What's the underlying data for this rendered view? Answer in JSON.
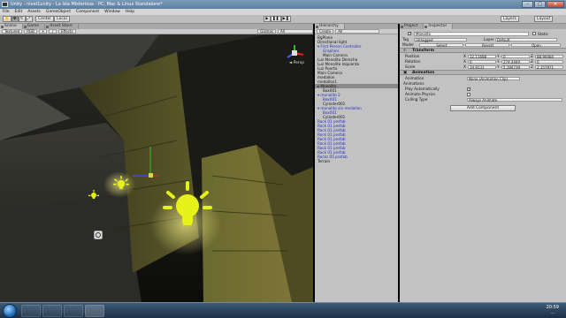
{
  "window": {
    "title": "Unity - nivel1unity - La Isla Misteriosa - PC, Mac & Linux Standalone*",
    "minimize": "–",
    "maximize": "□",
    "close": "✕"
  },
  "menu": [
    "File",
    "Edit",
    "Assets",
    "GameObject",
    "Component",
    "Window",
    "Help"
  ],
  "toolbar": {
    "pivot": "Center",
    "space": "Local",
    "play_icon": "play-icon",
    "pause_icon": "pause-icon",
    "step_icon": "step-icon",
    "layers": "Layers",
    "layout": "Layout"
  },
  "scene_panel": {
    "tabs": [
      "Scene",
      "Game",
      "Asset Store"
    ],
    "render_mode": "Textured",
    "color_mode": "RGB",
    "effects": "Effects",
    "gizmos": "Gizmos",
    "search": "All",
    "persp_label": "◄ Persp"
  },
  "hierarchy": {
    "tab": "Hierarchy",
    "create": "Create",
    "search": "All",
    "rows": [
      {
        "label": "BgPlane",
        "indent": 0,
        "prefab": false
      },
      {
        "label": "Directional light",
        "indent": 0,
        "prefab": false
      },
      {
        "label": "▾ First Person Controller",
        "indent": 0,
        "prefab": true
      },
      {
        "label": "Graphics",
        "indent": 2,
        "prefab": true
      },
      {
        "label": "Main Camera",
        "indent": 2,
        "prefab": false
      },
      {
        "label": "Luz Monolito Derecha",
        "indent": 0,
        "prefab": false
      },
      {
        "label": "Luz Monolito Izquierda",
        "indent": 0,
        "prefab": false
      },
      {
        "label": "Luz Puerta",
        "indent": 0,
        "prefab": false
      },
      {
        "label": "Main Camera",
        "indent": 0,
        "prefab": false
      },
      {
        "label": "medallon",
        "indent": 0,
        "prefab": false
      },
      {
        "label": "medallon1",
        "indent": 0,
        "prefab": false
      },
      {
        "label": "▸ Monolito",
        "indent": 0,
        "prefab": false,
        "selected": true
      },
      {
        "label": "Box001",
        "indent": 2,
        "prefab": false
      },
      {
        "label": "▾ monolito 2",
        "indent": 0,
        "prefab": true
      },
      {
        "label": "Box001",
        "indent": 2,
        "prefab": true
      },
      {
        "label": "Cylinder001",
        "indent": 2,
        "prefab": false
      },
      {
        "label": "▾ monolito sin medallon",
        "indent": 0,
        "prefab": true
      },
      {
        "label": "Box001",
        "indent": 2,
        "prefab": true
      },
      {
        "label": "Cylinder001",
        "indent": 2,
        "prefab": false
      },
      {
        "label": "Rock 01 prefab",
        "indent": 0,
        "prefab": true
      },
      {
        "label": "Rock 01 prefab",
        "indent": 0,
        "prefab": true
      },
      {
        "label": "Rock 01 prefab",
        "indent": 0,
        "prefab": true
      },
      {
        "label": "Rock 01 prefab",
        "indent": 0,
        "prefab": true
      },
      {
        "label": "Rock 01 prefab",
        "indent": 0,
        "prefab": true
      },
      {
        "label": "Rock 01 prefab",
        "indent": 0,
        "prefab": true
      },
      {
        "label": "Rock 01 prefab",
        "indent": 0,
        "prefab": true
      },
      {
        "label": "Rock 01 prefab",
        "indent": 0,
        "prefab": true
      },
      {
        "label": "Rocks 05 prefab",
        "indent": 0,
        "prefab": true
      },
      {
        "label": "Terrain",
        "indent": 0,
        "prefab": false
      }
    ]
  },
  "inspector": {
    "tabs": [
      "Project",
      "Inspector"
    ],
    "object_name": "Monolito",
    "static": "Static",
    "tag_label": "Tag",
    "tag_value": "Untagged",
    "layer_label": "Layer",
    "layer_value": "Default",
    "model_label": "Model",
    "model_buttons": [
      "Select",
      "Revert",
      "Open"
    ],
    "transform": {
      "title": "Transform",
      "rows": [
        {
          "label": "Position",
          "x": "32.11698",
          "y": "0",
          "z": "88.90084"
        },
        {
          "label": "Rotation",
          "x": "0",
          "y": "274.4444",
          "z": "0"
        },
        {
          "label": "Scale",
          "x": "34.9131",
          "y": "5.194739",
          "z": "2.157971"
        }
      ]
    },
    "animation": {
      "title": "Animation",
      "animation_label": "Animation",
      "animation_value": "None (Animation Clip)",
      "animations_label": "Animations",
      "play_auto_label": "Play Automatically",
      "play_auto": true,
      "animate_physics_label": "Animate Physics",
      "animate_physics": false,
      "culling_label": "Culling Type",
      "culling_value": "Always Animate"
    },
    "add_component": "Add Component"
  },
  "taskbar": {
    "time": "20:59",
    "date": "..."
  },
  "colors": {
    "light_icon": "#e6f019",
    "prefab_text": "#1f2fbf",
    "selection": "#8a8a8a"
  }
}
